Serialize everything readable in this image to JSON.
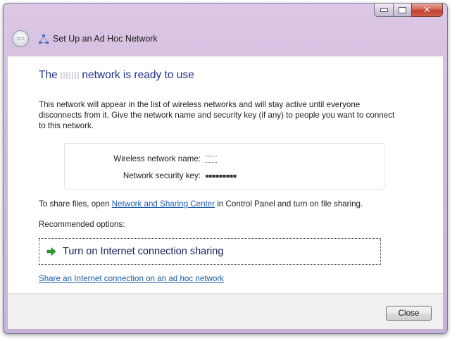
{
  "window": {
    "title": "Set Up an Ad Hoc Network",
    "caption_buttons": {
      "minimize_icon": "minimize-icon",
      "maximize_icon": "maximize-icon",
      "close_glyph": "✕"
    },
    "back_glyph": "⇦"
  },
  "main": {
    "heading_prefix": "The",
    "heading_suffix": "network is ready to use",
    "description": "This network will appear in the list of wireless networks and will stay active until everyone disconnects from it. Give the network name and security key (if any) to people you want to connect to this network.",
    "info": {
      "name_label": "Wireless network name:",
      "key_label": "Network security key:"
    },
    "share": {
      "prefix": "To share files, open",
      "link": "Network and Sharing Center",
      "suffix": "in Control Panel and turn on file sharing."
    },
    "recommended_label": "Recommended options:",
    "command_link": "Turn on Internet connection sharing",
    "bottom_link": "Share an Internet connection on an ad hoc network"
  },
  "footer": {
    "close_label": "Close"
  },
  "colors": {
    "heading": "#1e3287",
    "link": "#1a5aa8",
    "arrow_green": "#2f9d2f",
    "frame": "#cfb9dd"
  }
}
